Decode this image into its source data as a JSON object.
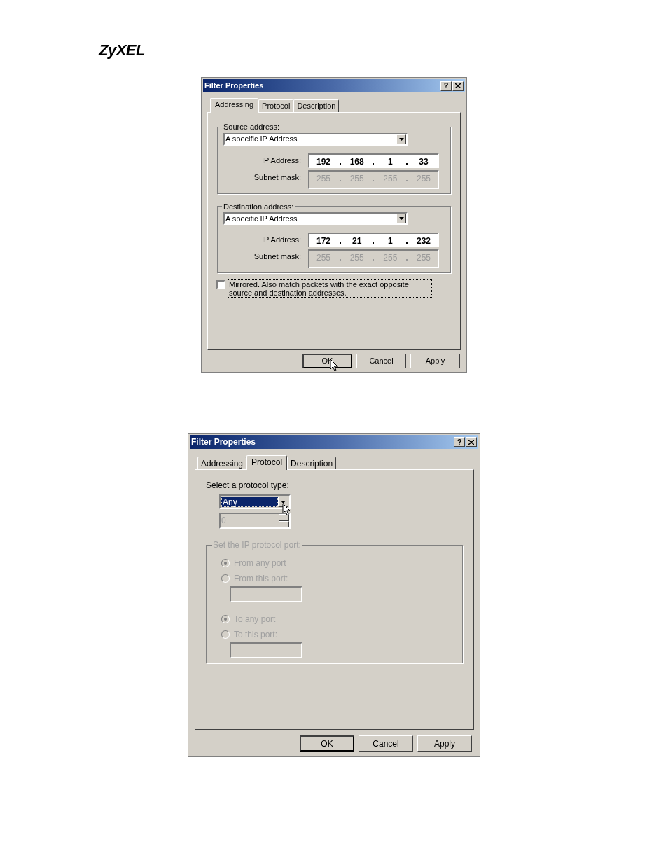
{
  "logo": "ZyXEL",
  "dialogs": [
    {
      "kind": "addressing",
      "title": "Filter Properties",
      "help_button": "?",
      "tabs": [
        {
          "label": "Addressing",
          "selected": true
        },
        {
          "label": "Protocol",
          "selected": false
        },
        {
          "label": "Description",
          "selected": false
        }
      ],
      "groups": [
        {
          "legend": "Source address:",
          "select": "A specific IP Address",
          "ip_label": "IP Address:",
          "ip": [
            "192",
            "168",
            "1",
            "33"
          ],
          "mask_label": "Subnet mask:",
          "mask": [
            "255",
            "255",
            "255",
            "255"
          ]
        },
        {
          "legend": "Destination address:",
          "select": "A specific IP Address",
          "ip_label": "IP Address:",
          "ip": [
            "172",
            "21",
            "1",
            "232"
          ],
          "mask_label": "Subnet mask:",
          "mask": [
            "255",
            "255",
            "255",
            "255"
          ]
        }
      ],
      "mirrored": {
        "label": "Mirrored. Also match packets with the exact opposite source and destination addresses.",
        "checked": false
      },
      "buttons": [
        {
          "label": "OK",
          "cursor": true
        },
        {
          "label": "Cancel",
          "cursor": false
        },
        {
          "label": "Apply",
          "cursor": false
        }
      ]
    },
    {
      "kind": "protocol",
      "title": "Filter Properties",
      "help_button": "?",
      "tabs": [
        {
          "label": "Addressing",
          "selected": false
        },
        {
          "label": "Protocol",
          "selected": true
        },
        {
          "label": "Description",
          "selected": false
        }
      ],
      "protocol_label": "Select a protocol type:",
      "protocol_select": {
        "value": "Any",
        "cursor": true
      },
      "protocol_number": {
        "value": "0",
        "disabled": true
      },
      "port_group": {
        "legend": "Set the IP protocol port:",
        "disabled": true,
        "rows": [
          {
            "kind": "radio",
            "label": "From any port",
            "selected": true
          },
          {
            "kind": "radio",
            "label": "From this port:",
            "selected": false
          },
          {
            "kind": "field"
          },
          {
            "kind": "radio",
            "label": "To any port",
            "selected": true
          },
          {
            "kind": "radio",
            "label": "To this port:",
            "selected": false
          },
          {
            "kind": "field"
          }
        ]
      },
      "buttons": [
        {
          "label": "OK",
          "cursor": false
        },
        {
          "label": "Cancel",
          "cursor": false
        },
        {
          "label": "Apply",
          "cursor": false
        }
      ]
    }
  ]
}
